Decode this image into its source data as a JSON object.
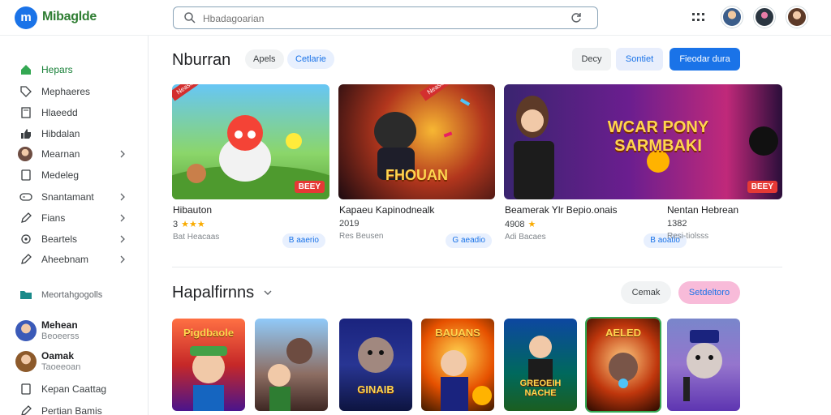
{
  "app": {
    "brand": "Mibaglde",
    "logo_letter": "m"
  },
  "search": {
    "placeholder": "Hbadagoarian"
  },
  "sidebar": {
    "items": [
      {
        "label": "Hepars",
        "icon": "home-icon",
        "chevron": false,
        "active": true
      },
      {
        "label": "Mephaeres",
        "icon": "tag-icon",
        "chevron": false
      },
      {
        "label": "Hlaeedd",
        "icon": "book-icon",
        "chevron": false
      },
      {
        "label": "Hibdalan",
        "icon": "thumb-icon",
        "chevron": false
      },
      {
        "label": "Mearnan",
        "icon": "avatar-icon",
        "chevron": true
      },
      {
        "label": "Medeleg",
        "icon": "doc-icon",
        "chevron": false
      },
      {
        "label": "Snantamant",
        "icon": "gamepad-icon",
        "chevron": true
      },
      {
        "label": "Fians",
        "icon": "pen-icon",
        "chevron": true
      },
      {
        "label": "Beartels",
        "icon": "gear-icon",
        "chevron": true
      },
      {
        "label": "Aheebnam",
        "icon": "pen-icon",
        "chevron": true
      }
    ],
    "section_label": "Meortahgogolls",
    "users": [
      {
        "name": "Mehean",
        "sub": "Beoeerss"
      },
      {
        "name": "Oamak",
        "sub": "Taoeeoan"
      }
    ],
    "extra": [
      {
        "label": "Kepan Caattag",
        "icon": "doc-icon"
      },
      {
        "label": "Pertian Bamis",
        "icon": "pen-icon"
      }
    ]
  },
  "section1": {
    "title": "Nburran",
    "chips": [
      "Apels",
      "Cetlarie"
    ],
    "buttons": {
      "b1": "Decy",
      "b2": "Sontiet",
      "b3": "Fieodar dura"
    },
    "tiles": [
      {
        "ribbon": "Neaseat",
        "tag": "BEEY",
        "title": "Hibauton",
        "meta": "3",
        "stars": "★★★",
        "sub": "Bat Heacaas",
        "badge": "B aaerio"
      },
      {
        "ribbon": "Neaseat",
        "tag": "",
        "title": "Kapaeu Kapinodnealk",
        "meta": "2019",
        "stars": "",
        "sub": "Res Beusen",
        "badge": "G aeadio"
      },
      {
        "ribbon": "",
        "tag": "BEEY",
        "title": "Beamerak Ylr Bepio.onais",
        "meta": "4908",
        "stars": "★",
        "sub": "Adi Bacaes",
        "badge": "B aoatio"
      },
      {
        "ribbon": "",
        "tag": "",
        "title": "Nentan Hebrean",
        "meta": "1382",
        "stars": "",
        "sub": "Resi-tiolsss",
        "badge": ""
      }
    ],
    "tile_titles": [
      "",
      "FHOUAN",
      "",
      "WCAR PONY SARMBAKI"
    ]
  },
  "section2": {
    "title": "Hapalfirnns",
    "buttons": {
      "b1": "Cemak",
      "b2": "Setdeltoro"
    },
    "cards": [
      "Pigdbaole",
      "",
      "",
      "BAUANS",
      "",
      "AELED",
      ""
    ],
    "card_bottom": [
      "",
      "",
      "GINAIB",
      "",
      "GREOEIH NACHE",
      "",
      ""
    ]
  },
  "colors": {
    "accent": "#1a73e8",
    "green": "#188038",
    "pink": "#f8bbd9"
  }
}
